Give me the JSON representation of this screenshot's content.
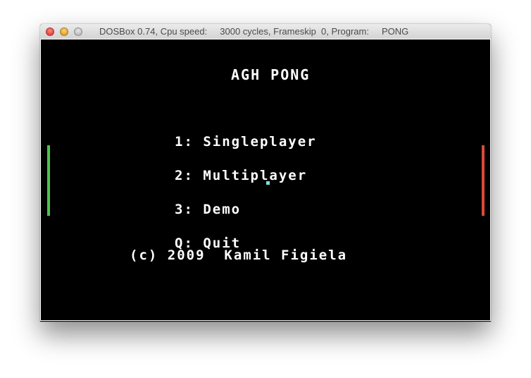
{
  "window": {
    "title": "DOSBox 0.74, Cpu speed:     3000 cycles, Frameskip  0, Program:     PONG"
  },
  "game": {
    "title": "AGH PONG",
    "menu": [
      {
        "key": "1:",
        "label": "Singleplayer"
      },
      {
        "key": "2:",
        "label": "Multiplayer"
      },
      {
        "key": "3:",
        "label": "Demo"
      },
      {
        "key": "Q:",
        "label": "Quit"
      }
    ],
    "copyright": "(c) 2009  Kamil Figiela",
    "colors": {
      "left_paddle": "#4cc54a",
      "right_paddle": "#d94a3a",
      "ball": "#7fe0e0",
      "text": "#ffffff",
      "background": "#000000"
    }
  }
}
